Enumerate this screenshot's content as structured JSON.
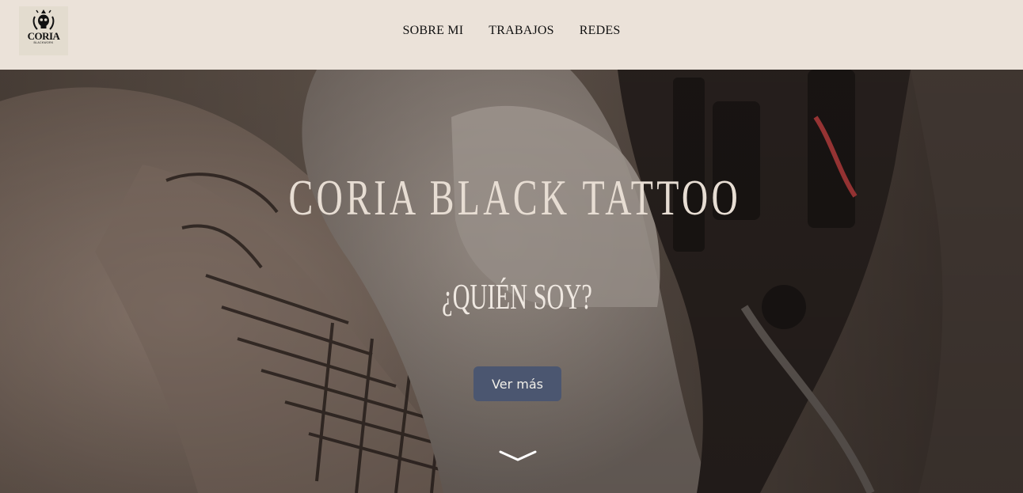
{
  "logo": {
    "name": "CORIA",
    "subtitle": "BLACKWORK"
  },
  "nav": {
    "items": [
      {
        "label": "SOBRE MI"
      },
      {
        "label": "TRABAJOS"
      },
      {
        "label": "REDES"
      }
    ]
  },
  "hero": {
    "title": "CORIA BLACK TATTOO",
    "subtitle": "¿QUIÉN SOY?",
    "button_label": "Ver más",
    "scroll_icon": "chevron-down-icon"
  },
  "colors": {
    "header_bg": "#ebe2d9",
    "button_bg": "#4b5670",
    "title_text": "#e7ddd3"
  }
}
